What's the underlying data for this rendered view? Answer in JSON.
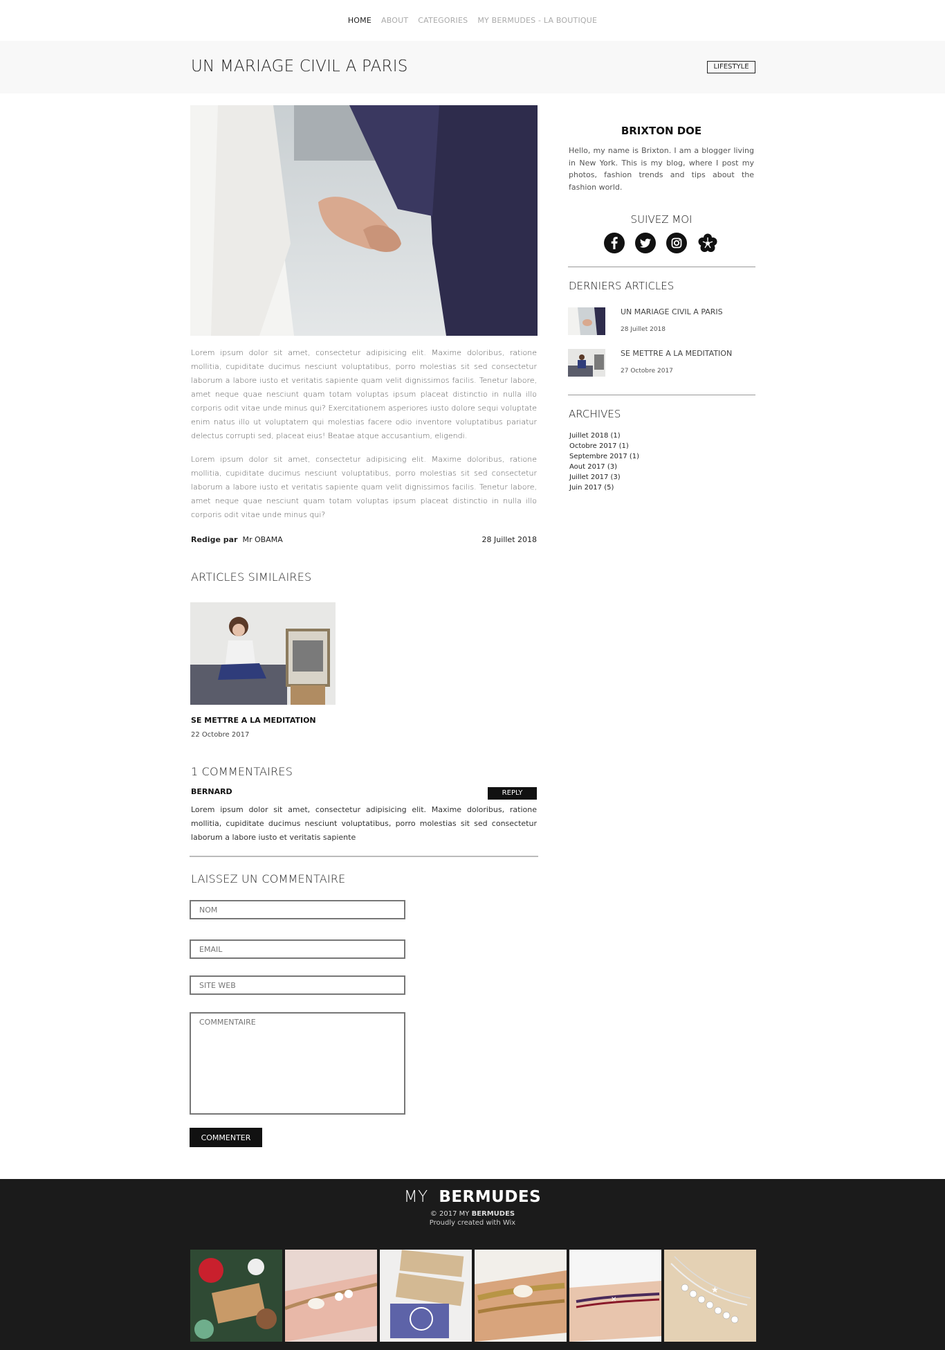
{
  "nav": {
    "items": [
      {
        "label": "HOME",
        "active": true
      },
      {
        "label": "ABOUT",
        "active": false
      },
      {
        "label": "CATEGORIES",
        "active": false
      },
      {
        "label": "MY BERMUDES - LA BOUTIQUE",
        "active": false
      }
    ]
  },
  "post": {
    "title": "UN MARIAGE CIVIL A PARIS",
    "category": "LIFESTYLE",
    "paragraphs": [
      "Lorem ipsum dolor sit amet, consectetur adipisicing elit. Maxime doloribus, ratione mollitia, cupiditate ducimus nesciunt voluptatibus, porro molestias sit sed consectetur laborum a labore iusto et veritatis sapiente quam velit dignissimos facilis. Tenetur labore, amet neque quae nesciunt quam totam voluptas ipsum placeat distinctio in nulla illo corporis odit vitae unde minus qui? Exercitationem asperiores iusto dolore sequi voluptate enim natus illo ut voluptatem qui molestias facere odio inventore voluptatibus pariatur delectus corrupti sed, placeat eius! Beatae atque accusantium, eligendi.",
      "Lorem ipsum dolor sit amet, consectetur adipisicing elit. Maxime doloribus, ratione mollitia, cupiditate ducimus nesciunt voluptatibus, porro molestias sit sed consectetur laborum a labore iusto et veritatis sapiente quam velit dignissimos facilis. Tenetur labore, amet neque quae nesciunt quam totam voluptas ipsum placeat distinctio in nulla illo corporis odit vitae unde minus qui?"
    ],
    "author_label": "Redige par",
    "author": "Mr OBAMA",
    "date": "28 Juillet 2018"
  },
  "similar": {
    "heading": "ARTICLES SIMILAIRES",
    "title": "SE METTRE A LA MEDITATION",
    "date": "22 Octobre 2017"
  },
  "comments": {
    "heading": "1 COMMENTAIRES",
    "author": "BERNARD",
    "reply_label": "REPLY",
    "text": "Lorem ipsum dolor sit amet, consectetur adipisicing elit. Maxime doloribus, ratione mollitia, cupiditate ducimus nesciunt voluptatibus, porro molestias sit sed consectetur laborum a labore iusto et veritatis sapiente"
  },
  "form": {
    "heading": "LAISSEZ UN COMMENTAIRE",
    "name_placeholder": "NOM",
    "email_placeholder": "EMAIL",
    "website_placeholder": "SITE WEB",
    "comment_placeholder": "COMMENTAIRE",
    "submit_label": "COMMENTER"
  },
  "sidebar": {
    "author_name": "BRIXTON DOE",
    "bio": "Hello, my name is Brixton. I am a blogger living in New York. This is my blog, where I post my photos, fashion trends and tips about the fashion world.",
    "follow_heading": "SUIVEZ MOI",
    "social_icons": [
      "facebook-icon",
      "twitter-icon",
      "instagram-icon",
      "flower-icon"
    ],
    "recent_heading": "DERNIERS ARTICLES",
    "recent": [
      {
        "title": "UN MARIAGE CIVIL A PARIS",
        "date": "28 Juillet 2018"
      },
      {
        "title": "SE METTRE A LA MEDITATION",
        "date": "27 Octobre 2017"
      }
    ],
    "archives_heading": "ARCHIVES",
    "archives": [
      "Juillet 2018 (1)",
      "Octobre 2017 (1)",
      "Septembre 2017 (1)",
      "Aout 2017 (3)",
      "Juillet 2017 (3)",
      "Juin 2017 (5)"
    ]
  },
  "footer": {
    "brand_light": "MY",
    "brand_bold": "BERMUDES",
    "copyright_prefix": "© 2017 MY",
    "copyright_bold": "BERMUDES",
    "credit": "Proudly created with Wix"
  },
  "colors": {
    "text": "#222222",
    "muted": "#aaaaaa",
    "title_band": "#f8f8f8",
    "footer_bg": "#1b1b1b",
    "button_bg": "#111111"
  }
}
